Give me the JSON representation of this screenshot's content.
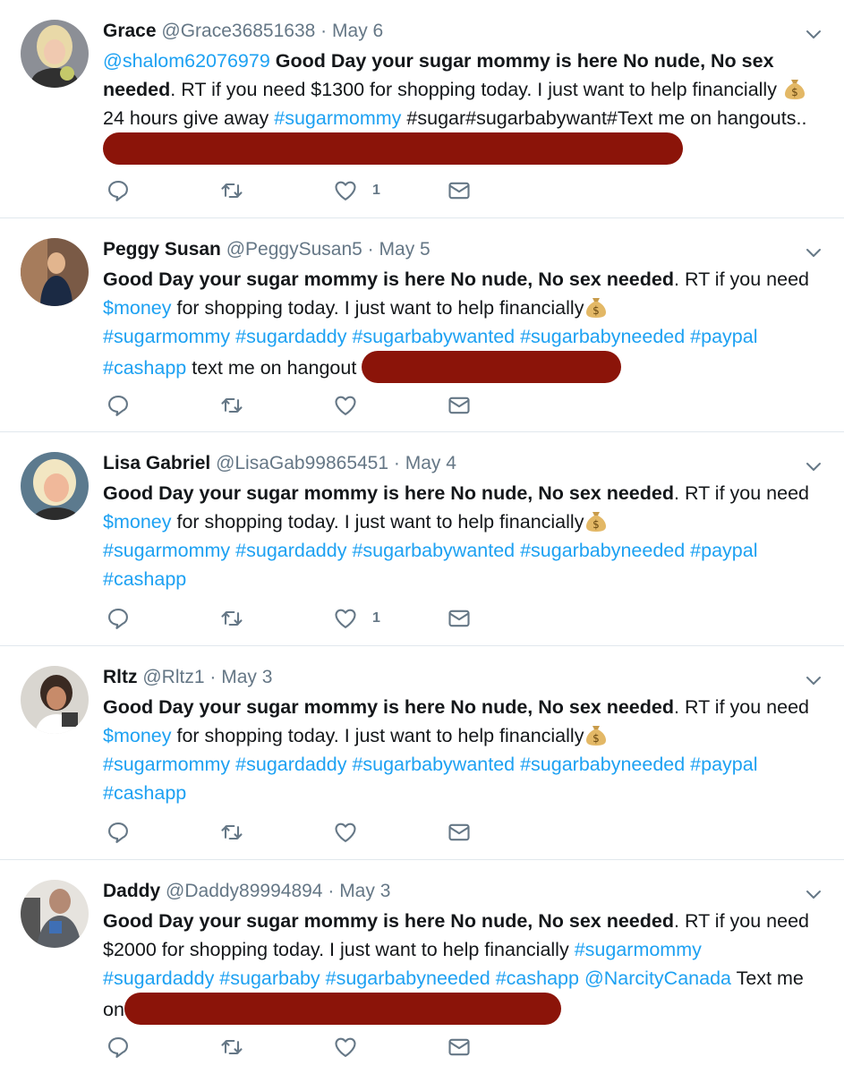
{
  "colors": {
    "accent": "#1da1f2",
    "redaction": "#8b1409",
    "muted": "#657786",
    "divider": "#e1e8ed"
  },
  "icons": {
    "reply": "reply-icon",
    "retweet": "retweet-icon",
    "like": "heart-icon",
    "dm": "envelope-icon",
    "menu": "chevron-down-icon",
    "emoji": "money-bag-icon"
  },
  "tweets": [
    {
      "name": "Grace",
      "handle": "@Grace36851638",
      "sep": "·",
      "date": "May 6",
      "mention": "@shalom62076979",
      "bold": "Good Day your sugar mommy is here No nude, No sex needed",
      "text1": ". RT if you need $1300 for shopping today. I just want to help financially",
      "text2": "24 hours give away",
      "tag1": "#sugarmommy",
      "text3": "#sugar#sugarbabywant#Text me on hangouts..",
      "likes": "1"
    },
    {
      "name": "Peggy Susan",
      "handle": "@PeggySusan5",
      "sep": "·",
      "date": "May 5",
      "bold": "Good Day your sugar mommy is here No nude, No sex needed",
      "text1": ". RT if you need",
      "cashtag": "$money",
      "text2": "for shopping today. I just want to help financially",
      "tags": "#sugarmommy #sugardaddy #sugarbabywanted #sugarbabyneeded #paypal",
      "tags2": "#cashapp",
      "text3": "text me on hangout",
      "likes": ""
    },
    {
      "name": "Lisa Gabriel",
      "handle": "@LisaGab99865451",
      "sep": "·",
      "date": "May 4",
      "bold": "Good Day your sugar mommy is here No nude, No sex needed",
      "text1": ". RT if you need",
      "cashtag": "$money",
      "text2": "for shopping today. I just want to help financially",
      "tags": "#sugarmommy #sugardaddy #sugarbabywanted #sugarbabyneeded #paypal",
      "tags2": "#cashapp",
      "likes": "1"
    },
    {
      "name": "Rltz",
      "handle": "@Rltz1",
      "sep": "·",
      "date": "May 3",
      "bold": "Good Day your sugar mommy is here No nude, No sex needed",
      "text1": ". RT if you need",
      "cashtag": "$money",
      "text2": "for shopping today. I just want to help financially",
      "tags": "#sugarmommy #sugardaddy #sugarbabywanted #sugarbabyneeded #paypal",
      "tags2": "#cashapp",
      "likes": ""
    },
    {
      "name": "Daddy",
      "handle": "@Daddy89994894",
      "sep": "·",
      "date": "May 3",
      "bold": "Good Day your sugar mommy is here No nude, No sex needed",
      "text1": ". RT if you need $2000 for shopping today. I just want to help financially",
      "tag1": "#sugarmommy",
      "tags": "#sugardaddy #sugarbaby #sugarbabyneeded",
      "tag2": "#cashapp",
      "mention": "@NarcityCanada",
      "text2": "Text me on",
      "likes": ""
    }
  ]
}
